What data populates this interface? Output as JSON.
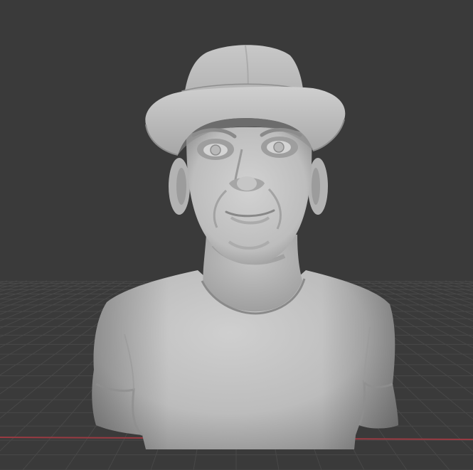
{
  "viewport": {
    "mode": "solid-shading",
    "background_color": "#3a3a3a",
    "grid_line_color": "#484848",
    "x_axis_color": "#9a3a42",
    "y_axis_color": "#6a8a2a",
    "model_base_color": "#b4b4b4"
  },
  "scene": {
    "object": "sculpted-bust-with-hat",
    "object_icon": "mesh-icon"
  }
}
